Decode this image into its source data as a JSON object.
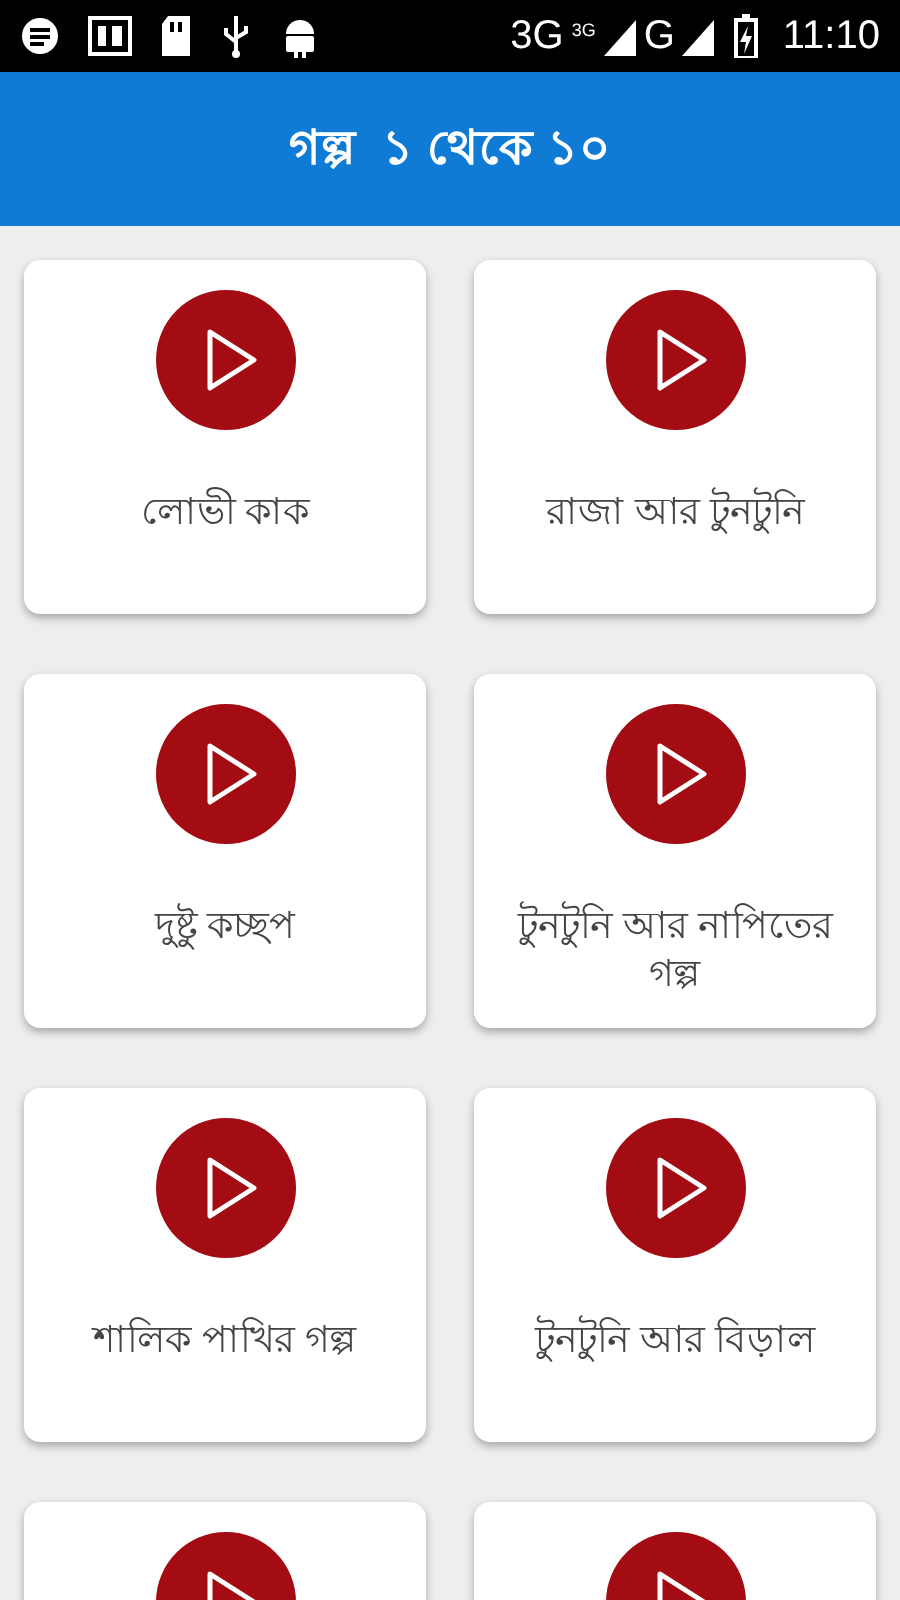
{
  "status_bar": {
    "network": "3G",
    "network_small": "3G",
    "network_2": "G",
    "time": "11:10"
  },
  "header": {
    "title": "গল্প  ১ থেকে ১০"
  },
  "cards": [
    {
      "kind": "story",
      "title": "লোভী কাক"
    },
    {
      "kind": "story",
      "title": "রাজা আর টুনটুনি"
    },
    {
      "kind": "story",
      "title": "দুষ্টু কচ্ছপ"
    },
    {
      "kind": "story",
      "title": "টুনটুনি আর নাপিতের গল্প"
    },
    {
      "kind": "story",
      "title": "শালিক পাখির গল্প"
    },
    {
      "kind": "story",
      "title": "টুনটুনি আর বিড়াল"
    },
    {
      "kind": "cut"
    },
    {
      "kind": "cut"
    }
  ]
}
